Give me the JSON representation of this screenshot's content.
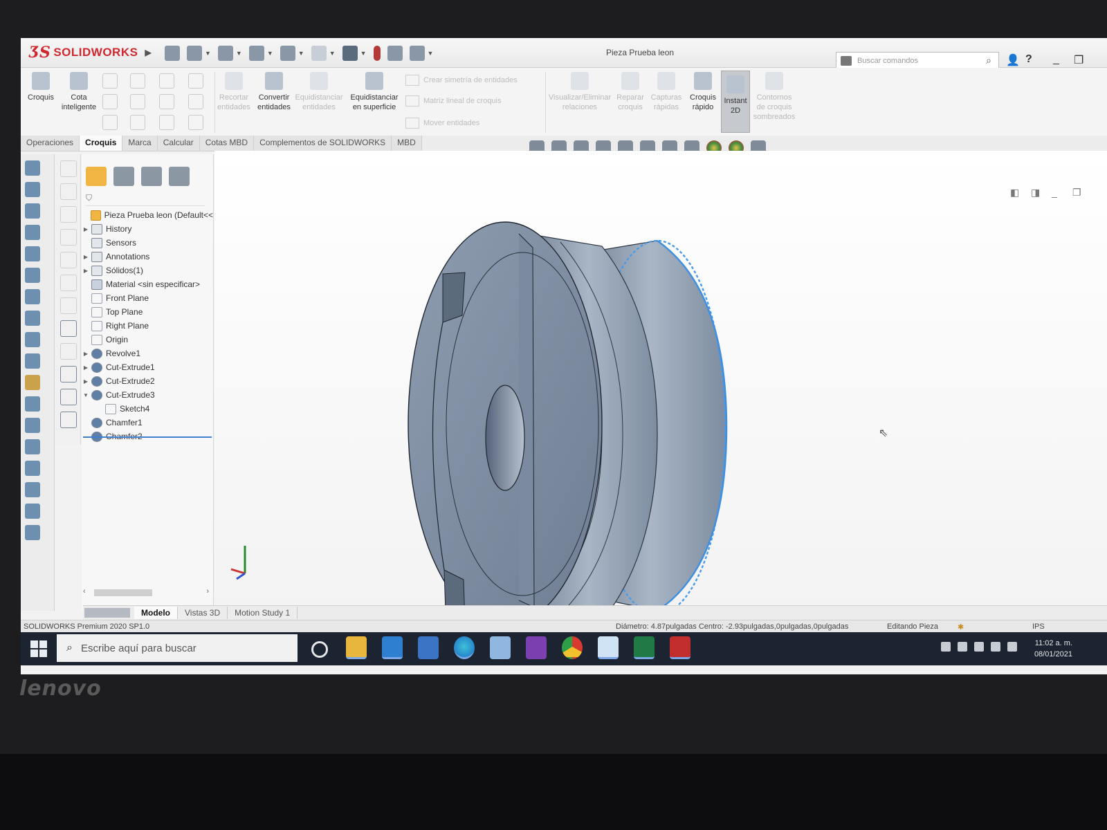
{
  "app": {
    "brand": "SOLIDWORKS",
    "document_title": "Pieza Prueba leon",
    "search_placeholder": "Buscar comandos"
  },
  "ribbon": {
    "buttons": [
      {
        "label": "Croquis",
        "enabled": true
      },
      {
        "label": "Cota inteligente",
        "enabled": true
      },
      {
        "label": "Recortar entidades",
        "enabled": false
      },
      {
        "label": "Convertir entidades",
        "enabled": true
      },
      {
        "label": "Equidistanciar entidades",
        "enabled": false
      },
      {
        "label": "Equidistanciar en superficie",
        "enabled": true
      },
      {
        "label": "Visualizar/Eliminar relaciones",
        "enabled": false
      },
      {
        "label": "Reparar croquis",
        "enabled": false
      },
      {
        "label": "Capturas rápidas",
        "enabled": false
      },
      {
        "label": "Croquis rápido",
        "enabled": true
      },
      {
        "label": "Instant 2D",
        "enabled": true,
        "active": true
      },
      {
        "label": "Contornos de croquis sombreados",
        "enabled": false
      }
    ],
    "small_buttons": [
      "Crear simetría de entidades",
      "Matriz lineal de croquis",
      "Mover entidades"
    ]
  },
  "tabs": [
    "Operaciones",
    "Croquis",
    "Marca",
    "Calcular",
    "Cotas MBD",
    "Complementos de SOLIDWORKS",
    "MBD"
  ],
  "active_tab": "Croquis",
  "feature_tree": {
    "root": "Pieza Prueba leon  (Default<<",
    "items": [
      {
        "label": "History",
        "expandable": true,
        "icon": "folder-icon"
      },
      {
        "label": "Sensors",
        "expandable": false,
        "icon": "sensor-icon"
      },
      {
        "label": "Annotations",
        "expandable": true,
        "icon": "annotation-icon"
      },
      {
        "label": "Sólidos(1)",
        "expandable": true,
        "icon": "solid-bodies-icon"
      },
      {
        "label": "Material <sin especificar>",
        "expandable": false,
        "icon": "material-icon"
      },
      {
        "label": "Front Plane",
        "expandable": false,
        "icon": "plane-icon"
      },
      {
        "label": "Top Plane",
        "expandable": false,
        "icon": "plane-icon"
      },
      {
        "label": "Right Plane",
        "expandable": false,
        "icon": "plane-icon"
      },
      {
        "label": "Origin",
        "expandable": false,
        "icon": "origin-icon"
      },
      {
        "label": "Revolve1",
        "expandable": true,
        "icon": "revolve-icon"
      },
      {
        "label": "Cut-Extrude1",
        "expandable": true,
        "icon": "cut-extrude-icon"
      },
      {
        "label": "Cut-Extrude2",
        "expandable": true,
        "icon": "cut-extrude-icon"
      },
      {
        "label": "Cut-Extrude3",
        "expandable": true,
        "expanded": true,
        "icon": "cut-extrude-icon"
      },
      {
        "label": "Sketch4",
        "expandable": false,
        "indent": true,
        "icon": "sketch-icon"
      },
      {
        "label": "Chamfer1",
        "expandable": false,
        "icon": "chamfer-icon"
      },
      {
        "label": "Chamfer2",
        "expandable": false,
        "icon": "chamfer-icon"
      }
    ]
  },
  "bottom_tabs": [
    "Modelo",
    "Vistas 3D",
    "Motion Study 1"
  ],
  "active_bottom_tab": "Modelo",
  "status_bar": {
    "version": "SOLIDWORKS Premium 2020 SP1.0",
    "measurement": "Diámetro: 4.87pulgadas  Centro: -2.93pulgadas,0pulgadas,0pulgadas",
    "mode": "Editando Pieza",
    "units": "IPS"
  },
  "taskbar": {
    "search_placeholder": "Escribe aquí para buscar",
    "time": "11:02 a. m.",
    "date": "08/01/2021"
  },
  "laptop_brand": "lenovo",
  "colors": {
    "brand_red": "#d0282e",
    "selection_blue": "#3f8fe0",
    "part_steel": "#8796a8",
    "taskbar": "#1b2430"
  }
}
